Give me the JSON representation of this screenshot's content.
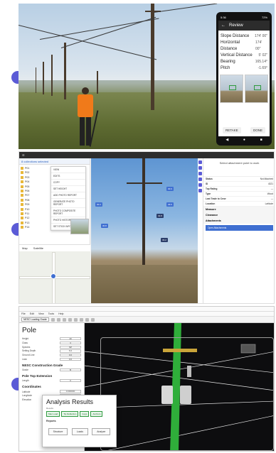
{
  "phone": {
    "status_time": "5:36",
    "status_right": "72%",
    "title": "Review",
    "measurements": [
      {
        "label": "Slope Distance",
        "value": "174' 00\""
      },
      {
        "label": "Horizontal Distance",
        "value": "174' 00\""
      },
      {
        "label": "Vertical Distance",
        "value": "5' 02\""
      },
      {
        "label": "Bearing",
        "value": "165.14°"
      },
      {
        "label": "Pitch",
        "value": "-1.69°"
      }
    ],
    "retake_label": "RETAKE",
    "done_label": "DONE"
  },
  "desktop": {
    "selected_label": "8 collections selected",
    "collections": [
      "P01",
      "P02",
      "P03",
      "P04",
      "P05",
      "P06",
      "P07",
      "P08",
      "P09",
      "P10",
      "P11",
      "P12",
      "P13",
      "P14"
    ],
    "menu_items": [
      "VIEW",
      "EDITS",
      "COPY",
      "SET HEIGHT",
      "ADD PHOTO REPORT",
      "GENERATE PHOTO REPORT",
      "PHOTO COMPOSITE REPORT",
      "PHOTO HISTORY",
      "SET STICK INFO"
    ],
    "map_tabs": [
      "Map",
      "Satellite"
    ],
    "attach_tags": [
      "30.4",
      "30.6",
      "29.6",
      "32.8",
      "30.8",
      "33.2"
    ],
    "right_header": "Select attachment point to work",
    "right_rows": [
      {
        "k": "Status",
        "v": "Not Attached"
      },
      {
        "k": "ID",
        "v": "4321"
      },
      {
        "k": "Top Rating",
        "v": "—"
      },
      {
        "k": "Type",
        "v": "Wood"
      },
      {
        "k": "Last Trade to Crew",
        "v": "—"
      },
      {
        "k": "Location",
        "v": "Latitude"
      }
    ],
    "right_sections": [
      "Measure",
      "Clearance",
      "Attachments"
    ],
    "right_highlight": "Open Attachments"
  },
  "analysis": {
    "menu": [
      "File",
      "Edit",
      "View",
      "Tools",
      "Help"
    ],
    "model_select": "NESC Loading Grade",
    "heading": "Pole",
    "pole_fields": [
      {
        "label": "Height",
        "value": "40"
      },
      {
        "label": "Class",
        "value": "3"
      },
      {
        "label": "Species",
        "value": "SP"
      },
      {
        "label": "Setting Depth",
        "value": "6.0"
      },
      {
        "label": "Ground Line",
        "value": "0.0"
      },
      {
        "label": "Lean",
        "value": "0.0"
      }
    ],
    "nesc_heading": "NESC Construction Grade",
    "nesc_field": {
      "label": "Grade",
      "value": "B"
    },
    "pole_top_heading": "Pole Top Extension",
    "pole_top_field": {
      "label": "Length",
      "value": "0"
    },
    "coord_heading": "Coordinates",
    "coord_fields": [
      {
        "label": "Latitude",
        "value": "0.000000"
      },
      {
        "label": "Longitude",
        "value": "0.000000"
      },
      {
        "label": "Elevation",
        "value": "0"
      }
    ],
    "dialog": {
      "title": "Analysis Results",
      "subtitle": "Results",
      "checks": [
        "Max Load",
        "Tip Deflection",
        "Guys",
        "Anchors"
      ],
      "reports_label": "Reports",
      "buttons": [
        "Structure",
        "Loads",
        "Analyze"
      ]
    }
  }
}
